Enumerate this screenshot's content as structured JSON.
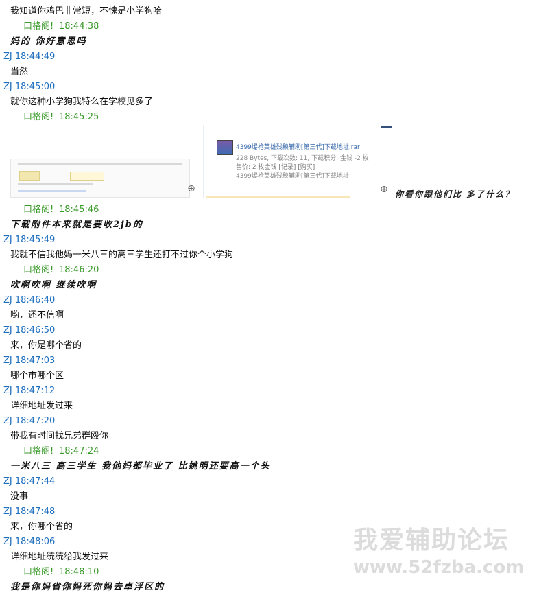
{
  "rows": [
    {
      "kind": "msg",
      "text": "我知道你鸡巴非常短，不愧是小学狗哈"
    },
    {
      "kind": "me",
      "nick": "口格阁!",
      "time": "18:44:38"
    },
    {
      "kind": "msg",
      "hand": true,
      "text": "妈的 你好意思吗"
    },
    {
      "kind": "zj",
      "text": "ZJ 18:44:49"
    },
    {
      "kind": "msg",
      "text": "当然"
    },
    {
      "kind": "zj",
      "text": "ZJ 18:45:00"
    },
    {
      "kind": "msg",
      "text": "就你这种小学狗我特么在学校见多了"
    },
    {
      "kind": "me",
      "nick": "口格阁!",
      "time": "18:45:25"
    }
  ],
  "images": {
    "thumb2_title": "4399爆枪英雄残秧辅助[第三代]下载地址.rar",
    "thumb2_line2": "228 Bytes, 下载次数: 11, 下载积分: 金钱 -2 枚",
    "thumb2_line3": "售价: 2 枚金钱  [记录]  [购买]",
    "thumb2_line4": "4399爆枪英雄残秧辅助[第三代]下载地址",
    "caption": "你看你跟他们比 多了什么？"
  },
  "rows2": [
    {
      "kind": "me",
      "nick": "口格阁!",
      "time": "18:45:46"
    },
    {
      "kind": "msg",
      "hand": true,
      "text": "下载附件本来就是要收2jb的"
    },
    {
      "kind": "zj",
      "text": "ZJ 18:45:49"
    },
    {
      "kind": "msg",
      "text": "我就不信我他妈一米八三的高三学生还打不过你个小学狗"
    },
    {
      "kind": "me",
      "nick": "口格阁!",
      "time": "18:46:20"
    },
    {
      "kind": "msg",
      "hand": true,
      "text": "吹啊吹啊 继续吹啊"
    },
    {
      "kind": "zj",
      "text": "ZJ 18:46:40"
    },
    {
      "kind": "msg",
      "text": "哟，还不信啊"
    },
    {
      "kind": "zj",
      "text": "ZJ 18:46:50"
    },
    {
      "kind": "msg",
      "text": "来，你是哪个省的"
    },
    {
      "kind": "zj",
      "text": "ZJ 18:47:03"
    },
    {
      "kind": "msg",
      "text": "哪个市哪个区"
    },
    {
      "kind": "zj",
      "text": "ZJ 18:47:12"
    },
    {
      "kind": "msg",
      "text": "详细地址发过来"
    },
    {
      "kind": "zj",
      "text": "ZJ 18:47:20"
    },
    {
      "kind": "msg",
      "text": "带我有时间找兄弟群殴你"
    },
    {
      "kind": "me",
      "nick": "口格阁!",
      "time": "18:47:24"
    },
    {
      "kind": "msg",
      "hand": true,
      "text": "一米八三 高三学生 我他妈都毕业了 比姚明还要高一个头"
    },
    {
      "kind": "zj",
      "text": "ZJ 18:47:44"
    },
    {
      "kind": "msg",
      "text": "没事"
    },
    {
      "kind": "zj",
      "text": "ZJ 18:47:48"
    },
    {
      "kind": "msg",
      "text": "来，你哪个省的"
    },
    {
      "kind": "zj",
      "text": "ZJ 18:48:06"
    },
    {
      "kind": "msg",
      "text": "详细地址统统给我发过来"
    },
    {
      "kind": "me",
      "nick": "口格阁!",
      "time": "18:48:10"
    },
    {
      "kind": "msg",
      "hand": true,
      "text": "我是你妈省你妈死你妈去卓浮区的"
    }
  ],
  "watermark": {
    "line1": "我爱辅助论坛",
    "line2": "www.52fzba.com"
  }
}
